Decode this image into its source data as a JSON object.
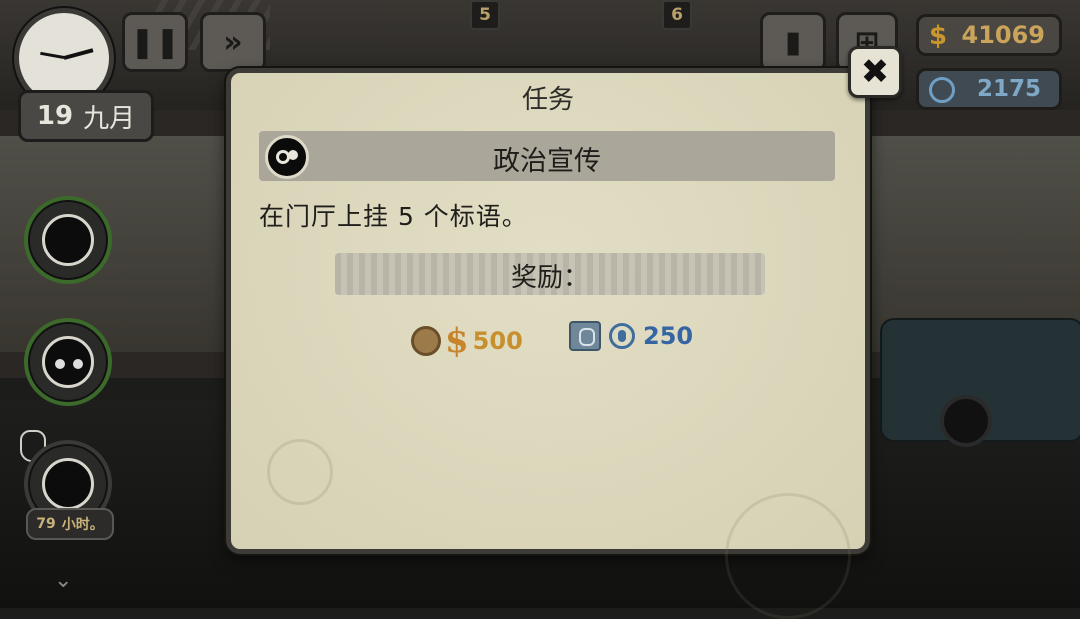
{
  "hud": {
    "date_day": "19",
    "date_month": "九月",
    "floor_left": "5",
    "floor_right": "6",
    "money": "41069",
    "points": "2175",
    "pause_icon": "pause-icon",
    "fastforward_icon": "fast-forward-icon",
    "bag_icon": "bag-icon",
    "cart_icon": "cart-icon"
  },
  "left_panel": {
    "hours_value": "79",
    "hours_unit": "小时。"
  },
  "dialog": {
    "title": "任务",
    "mission_name": "政治宣传",
    "description": "在门厅上挂 5 个标语。",
    "reward_label": "奖励：",
    "reward_money_symbol": "$",
    "reward_money": "500",
    "reward_points": "250",
    "close_icon": "close-icon"
  }
}
